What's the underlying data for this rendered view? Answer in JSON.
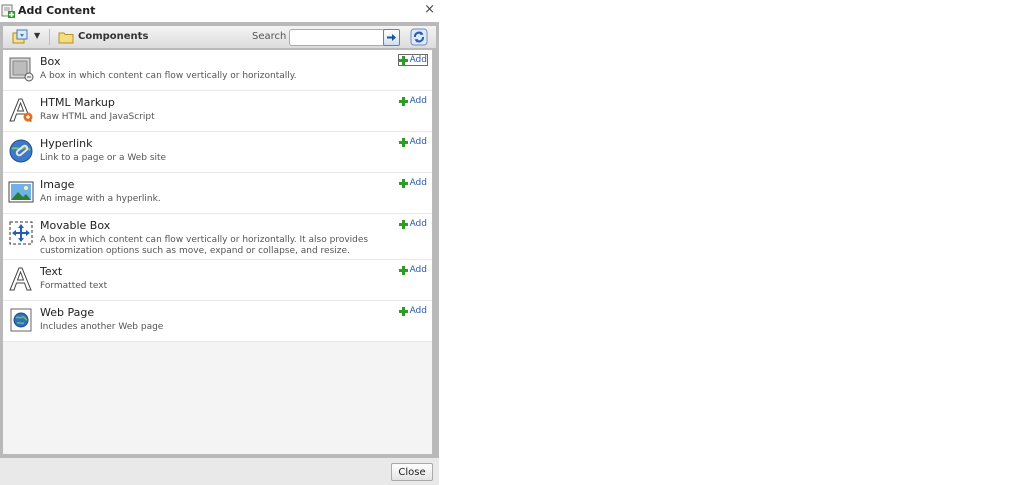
{
  "dialog": {
    "title": "Add Content",
    "close_glyph": "×",
    "close_button_label": "Close"
  },
  "toolbar": {
    "folder_label": "Components",
    "search_label": "Search",
    "search_value": ""
  },
  "components": [
    {
      "title": "Box",
      "description": "A box in which content can flow vertically or horizontally.",
      "icon": "box-icon",
      "add_label": "Add"
    },
    {
      "title": "HTML Markup",
      "description": "Raw HTML and JavaScript",
      "icon": "html-markup-icon",
      "add_label": "Add"
    },
    {
      "title": "Hyperlink",
      "description": "Link to a page or a Web site",
      "icon": "hyperlink-icon",
      "add_label": "Add"
    },
    {
      "title": "Image",
      "description": "An image with a hyperlink.",
      "icon": "image-icon",
      "add_label": "Add"
    },
    {
      "title": "Movable Box",
      "description": "A box in which content can flow vertically or horizontally. It also provides customization options such as move, expand or collapse, and resize.",
      "icon": "movable-box-icon",
      "add_label": "Add"
    },
    {
      "title": "Text",
      "description": "Formatted text",
      "icon": "text-icon",
      "add_label": "Add"
    },
    {
      "title": "Web Page",
      "description": "Includes another Web page",
      "icon": "web-page-icon",
      "add_label": "Add"
    }
  ],
  "colors": {
    "link": "#2a5aa8",
    "plus": "#2f9a26",
    "panel_border": "#b9b9b9"
  }
}
